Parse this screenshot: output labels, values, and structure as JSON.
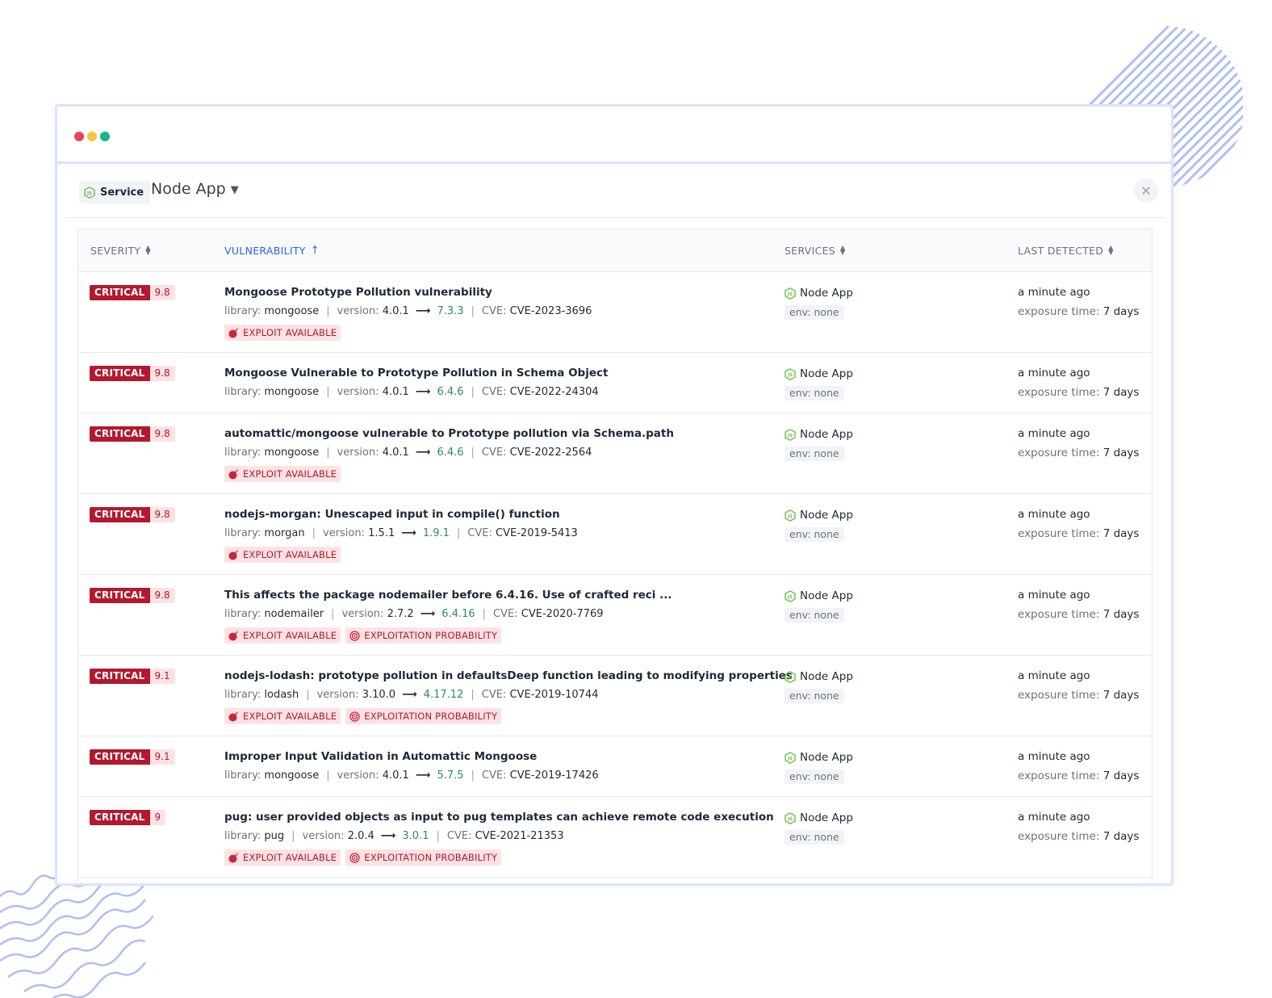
{
  "colors": {
    "critical": "#b3192e",
    "critical_light": "#fde2e4",
    "fix_version": "#2e8b57",
    "sort_active": "#2563eb",
    "node_green": "#6cbf4a"
  },
  "header": {
    "service_label": "Service",
    "service_name": "Node App"
  },
  "columns": {
    "severity": "SEVERITY",
    "vulnerability": "VULNERABILITY",
    "services": "SERVICES",
    "last_detected": "LAST DETECTED"
  },
  "labels": {
    "library": "library:",
    "version": "version:",
    "cve": "CVE:",
    "exposure": "exposure time:",
    "exploit": "EXPLOIT AVAILABLE",
    "probability": "EXPLOITATION PROBABILITY"
  },
  "rows": [
    {
      "severity": "CRITICAL",
      "score": "9.8",
      "title": "Mongoose Prototype Pollution vulnerability",
      "library": "mongoose",
      "version": "4.0.1",
      "fix": "7.3.3",
      "cve": "CVE-2023-3696",
      "exploit": true,
      "probability": false,
      "service": "Node App",
      "env": "env: none",
      "last": "a minute ago",
      "exposure": "7 days"
    },
    {
      "severity": "CRITICAL",
      "score": "9.8",
      "title": "Mongoose Vulnerable to Prototype Pollution in Schema Object",
      "library": "mongoose",
      "version": "4.0.1",
      "fix": "6.4.6",
      "cve": "CVE-2022-24304",
      "exploit": false,
      "probability": false,
      "service": "Node App",
      "env": "env: none",
      "last": "a minute ago",
      "exposure": "7 days"
    },
    {
      "severity": "CRITICAL",
      "score": "9.8",
      "title": "automattic/mongoose vulnerable to Prototype pollution via Schema.path",
      "library": "mongoose",
      "version": "4.0.1",
      "fix": "6.4.6",
      "cve": "CVE-2022-2564",
      "exploit": true,
      "probability": false,
      "service": "Node App",
      "env": "env: none",
      "last": "a minute ago",
      "exposure": "7 days"
    },
    {
      "severity": "CRITICAL",
      "score": "9.8",
      "title": "nodejs-morgan: Unescaped input in compile() function",
      "library": "morgan",
      "version": "1.5.1",
      "fix": "1.9.1",
      "cve": "CVE-2019-5413",
      "exploit": true,
      "probability": false,
      "service": "Node App",
      "env": "env: none",
      "last": "a minute ago",
      "exposure": "7 days"
    },
    {
      "severity": "CRITICAL",
      "score": "9.8",
      "title": "This affects the package nodemailer before 6.4.16. Use of crafted reci ...",
      "library": "nodemailer",
      "version": "2.7.2",
      "fix": "6.4.16",
      "cve": "CVE-2020-7769",
      "exploit": true,
      "probability": true,
      "service": "Node App",
      "env": "env: none",
      "last": "a minute ago",
      "exposure": "7 days"
    },
    {
      "severity": "CRITICAL",
      "score": "9.1",
      "title": "nodejs-lodash: prototype pollution in defaultsDeep function leading to modifying properties",
      "library": "lodash",
      "version": "3.10.0",
      "fix": "4.17.12",
      "cve": "CVE-2019-10744",
      "exploit": true,
      "probability": true,
      "service": "Node App",
      "env": "env: none",
      "last": "a minute ago",
      "exposure": "7 days"
    },
    {
      "severity": "CRITICAL",
      "score": "9.1",
      "title": "Improper Input Validation in Automattic Mongoose",
      "library": "mongoose",
      "version": "4.0.1",
      "fix": "5.7.5",
      "cve": "CVE-2019-17426",
      "exploit": false,
      "probability": false,
      "service": "Node App",
      "env": "env: none",
      "last": "a minute ago",
      "exposure": "7 days"
    },
    {
      "severity": "CRITICAL",
      "score": "9",
      "title": "pug: user provided objects as input to pug templates can achieve remote code execution",
      "library": "pug",
      "version": "2.0.4",
      "fix": "3.0.1",
      "cve": "CVE-2021-21353",
      "exploit": true,
      "probability": true,
      "service": "Node App",
      "env": "env: none",
      "last": "a minute ago",
      "exposure": "7 days"
    }
  ]
}
